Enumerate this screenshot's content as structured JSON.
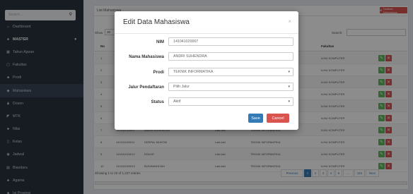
{
  "sidebar": {
    "search_placeholder": "Search...",
    "items": [
      {
        "icon": "dashboard-icon",
        "glyph": "⌂",
        "label": "Dashboard"
      },
      {
        "icon": "sitemap-icon",
        "glyph": "♣",
        "label": "MASTER"
      },
      {
        "icon": "calendar-icon",
        "glyph": "▦",
        "label": "Tahun Ajaran"
      },
      {
        "icon": "building-icon",
        "glyph": "▢",
        "label": "Fakultas"
      },
      {
        "icon": "book-icon",
        "glyph": "■",
        "label": "Prodi"
      },
      {
        "icon": "graduation-cap-icon",
        "glyph": "◆",
        "label": "Mahasiswa"
      },
      {
        "icon": "user-icon",
        "glyph": "♟",
        "label": "Dosen"
      },
      {
        "icon": "tag-icon",
        "glyph": "◤",
        "label": "MTK"
      },
      {
        "icon": "users-icon",
        "glyph": "♣",
        "label": "Nilai"
      },
      {
        "icon": "door-icon",
        "glyph": "▯",
        "label": "Kelas"
      },
      {
        "icon": "clock-icon",
        "glyph": "◉",
        "label": "Jadwal"
      },
      {
        "icon": "table-icon",
        "glyph": "▤",
        "label": "Biaodara"
      },
      {
        "icon": "group-icon",
        "glyph": "♣",
        "label": "Agama"
      },
      {
        "icon": "map-icon",
        "glyph": "■",
        "label": "Isi Provinsi"
      }
    ]
  },
  "main": {
    "panel_title": "List Mahasiswa",
    "add_button": "Tambah Mahasiswa",
    "show_label": "Show",
    "show_value": "10",
    "search_label": "Search:",
    "columns": {
      "no": "No",
      "fakultas": "Fakultas"
    },
    "rows": [
      {
        "no": "1",
        "nim": "141041020001",
        "nama": "AGUNG PRAKOSO",
        "jk": "Laki-laki",
        "prodi": "TEKNIK INFORMATIKA",
        "fak": "ILMU KOMPUTER"
      },
      {
        "no": "2",
        "nim": "141041020002",
        "nama": "AHMAD FAUZI",
        "jk": "Laki-laki",
        "prodi": "TEKNIK INFORMATIKA",
        "fak": "ILMU KOMPUTER"
      },
      {
        "no": "3",
        "nim": "141041020003",
        "nama": "AHMAD RIZKI",
        "jk": "Laki-laki",
        "prodi": "TEKNIK INFORMATIKA",
        "fak": "ILMU KOMPUTER"
      },
      {
        "no": "4",
        "nim": "141041020004",
        "nama": "AJI PAMUNGKAS",
        "jk": "Laki-laki",
        "prodi": "TEKNIK INFORMATIKA",
        "fak": "ILMU KOMPUTER"
      },
      {
        "no": "5",
        "nim": "141041020005",
        "nama": "ANDI SETIAWAN",
        "jk": "Laki-laki",
        "prodi": "TEKNIK INFORMATIKA",
        "fak": "ILMU KOMPUTER"
      },
      {
        "no": "6",
        "nim": "141041020006",
        "nama": "ANDRE WIJAYA",
        "jk": "Laki-laki",
        "prodi": "TEKNIK INFORMATIKA",
        "fak": "ILMU KOMPUTER"
      },
      {
        "no": "7",
        "nim": "141041020007",
        "nama": "ANDRI SUHENDRA",
        "jk": "Laki-laki",
        "prodi": "TEKNIK INFORMATIKA",
        "fak": "ILMU KOMPUTER"
      },
      {
        "no": "8",
        "nim": "141041020011",
        "nama": "DERPAL MUKOM",
        "jk": "Laki-laki",
        "prodi": "TEKNIK INFORMATIKA",
        "fak": "ILMU KOMPUTER"
      },
      {
        "no": "9",
        "nim": "141041020012",
        "nama": "EDKHR",
        "jk": "Laki-laki",
        "prodi": "TEKNIK INFORMATIKA",
        "fak": "ILMU KOMPUTER"
      },
      {
        "no": "10",
        "nim": "141041020013",
        "nama": "BUDIMANSYAH",
        "jk": "Laki-laki",
        "prodi": "TEKNIK INFORMATIKA",
        "fak": "ILMU KOMPUTER"
      }
    ],
    "info": "Showing 1 to 10 of 1,237 entries",
    "pagination": {
      "prev": "Previous",
      "pages": [
        "1",
        "2",
        "3",
        "4",
        "5",
        "...",
        "124"
      ],
      "next": "Next"
    }
  },
  "modal": {
    "title": "Edit Data Mahasiswa",
    "close": "×",
    "fields": {
      "nim_label": "NIM",
      "nim_value": "141041020007",
      "nama_label": "Nama Mahasiswa",
      "nama_value": "ANDRI SUHENDRA",
      "prodi_label": "Prodi",
      "prodi_value": "TEKNIK INFORMATIKA",
      "jalur_label": "Jalur Pendaftaran",
      "jalur_value": "Pilih Jalur",
      "status_label": "Status",
      "status_value": "Aktif"
    },
    "save_label": "Save",
    "cancel_label": "Cancel"
  },
  "colors": {
    "sidebar": "#2b3341",
    "primary": "#337ab7",
    "danger": "#d9534f",
    "success": "#5cb85c"
  }
}
